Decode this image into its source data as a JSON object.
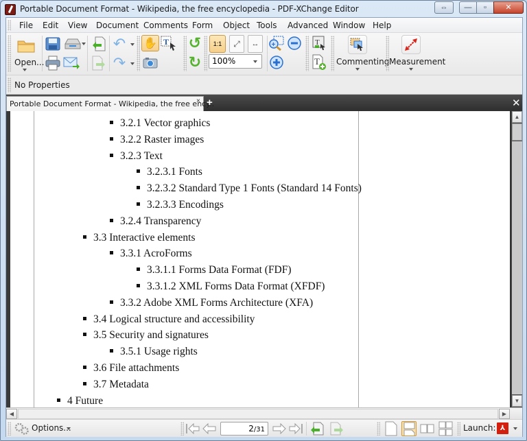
{
  "window": {
    "title": "Portable Document Format - Wikipedia, the free encyclopedia - PDF-XChange Editor",
    "controls": {
      "swap": "⇔",
      "minimize": "—",
      "maximize": "▫",
      "close": "✕"
    }
  },
  "menubar": {
    "items": [
      "File",
      "Edit",
      "View",
      "Document",
      "Comments",
      "Form",
      "Object",
      "Tools",
      "Advanced",
      "Window",
      "Help"
    ]
  },
  "toolbar": {
    "open_label": "Open...",
    "zoom_value": "100%",
    "commenting_label": "Commenting",
    "measurement_label": "Measurement",
    "active_tool": "hand-tool",
    "icons": {
      "open": "📂",
      "save": "💾",
      "scan": "🖨",
      "print": "🖶",
      "email": "✉",
      "import": "⬅",
      "export": "➡",
      "undo": "↶",
      "redo": "↷",
      "hand": "✋",
      "select_text": "T",
      "snapshot": "📷",
      "rotate_left": "↺",
      "rotate_right": "↻",
      "actual_size": "1:1",
      "fit_page": "⤢",
      "fit_width": "↔",
      "zoom_rect": "⊕",
      "zoom_out": "−",
      "zoom_in": "+",
      "typewriter": "T",
      "add_text": "T+"
    }
  },
  "properties_bar": {
    "label": "No Properties"
  },
  "tabs": {
    "document_tab": "Portable Document Format - Wikipedia, the free ency..",
    "close": "×",
    "new_tab": "+",
    "close_all": "✕"
  },
  "document": {
    "toc": [
      {
        "level": 3,
        "text": "3.2.1 Vector graphics"
      },
      {
        "level": 3,
        "text": "3.2.2 Raster images"
      },
      {
        "level": 3,
        "text": "3.2.3 Text"
      },
      {
        "level": 4,
        "text": "3.2.3.1 Fonts"
      },
      {
        "level": 4,
        "text": "3.2.3.2 Standard Type 1 Fonts (Standard 14 Fonts)"
      },
      {
        "level": 4,
        "text": "3.2.3.3 Encodings"
      },
      {
        "level": 3,
        "text": "3.2.4 Transparency"
      },
      {
        "level": 2,
        "text": "3.3 Interactive elements"
      },
      {
        "level": 3,
        "text": "3.3.1 AcroForms"
      },
      {
        "level": 4,
        "text": "3.3.1.1 Forms Data Format (FDF)"
      },
      {
        "level": 4,
        "text": "3.3.1.2 XML Forms Data Format (XFDF)"
      },
      {
        "level": 3,
        "text": "3.3.2 Adobe XML Forms Architecture (XFA)"
      },
      {
        "level": 2,
        "text": "3.4 Logical structure and accessibility"
      },
      {
        "level": 2,
        "text": "3.5 Security and signatures"
      },
      {
        "level": 3,
        "text": "3.5.1 Usage rights"
      },
      {
        "level": 2,
        "text": "3.6 File attachments"
      },
      {
        "level": 2,
        "text": "3.7 Metadata"
      },
      {
        "level": 1,
        "text": "4 Future"
      }
    ]
  },
  "statusbar": {
    "options_label": "Options...",
    "current_page": "2",
    "total_pages": "/31",
    "launch_label": "Launch:",
    "launch_app_icon": "pdf-app-icon"
  }
}
